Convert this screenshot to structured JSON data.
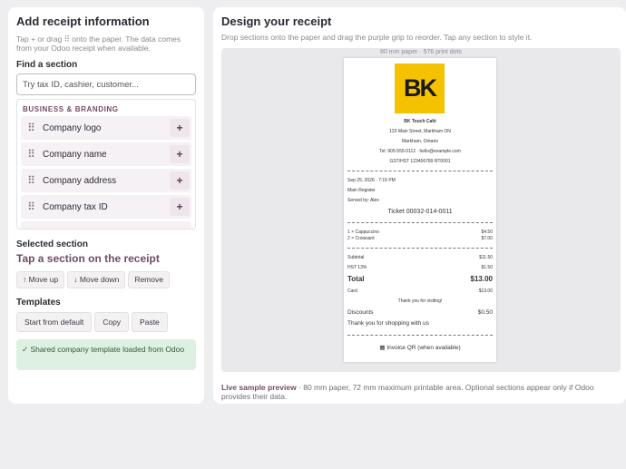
{
  "left": {
    "title": "Add receipt information",
    "hint": "Tap + or drag ⠿ onto the paper. The data comes from your Odoo receipt when available.",
    "find_label": "Find a section",
    "search_placeholder": "Try tax ID, cashier, customer...",
    "category": "BUSINESS & BRANDING",
    "items": [
      {
        "label": "Company logo",
        "add": "+"
      },
      {
        "label": "Company name",
        "add": "+"
      },
      {
        "label": "Company address",
        "add": "+"
      },
      {
        "label": "Company tax ID",
        "add": "+"
      }
    ],
    "grip": "⠿",
    "selected_label": "Selected section",
    "selected_value": "Tap a section on the receipt",
    "move_up": "↑ Move up",
    "move_down": "↓ Move down",
    "remove": "Remove",
    "templates_label": "Templates",
    "start_default": "Start from default",
    "copy": "Copy",
    "paste": "Paste",
    "template_status": "✓ Shared company template loaded from Odoo"
  },
  "right": {
    "title": "Design your receipt",
    "hint": "Drop sections onto the paper and drag the purple grip to reorder. Tap any section to style it.",
    "paper_caption": "80 mm paper · 576 print dots",
    "caption_bold": "Live sample preview",
    "caption_rest": " · 80 mm paper, 72 mm maximum printable area. Optional sections appear only if Odoo provides their data."
  },
  "receipt": {
    "logo_text": "BK",
    "company_name": "BK Touch Café",
    "address1": "123 Main Street, Markham ON",
    "address2": "Markham, Ontario",
    "contact": "Tel: 905-555-0112 · hello@example.com",
    "tax": "GST/HST 123456789 RT0001",
    "datetime": "Sep 25, 2026 · 7:15 PM",
    "register": "Main Register",
    "served_by": "Served by: Alex",
    "ticket": "Ticket 00032-014-0011",
    "lines": [
      {
        "item": "1 × Cappuccino",
        "price": "$4.50"
      },
      {
        "item": "2 × Croissant",
        "price": "$7.00"
      }
    ],
    "subtotal_label": "Subtotal",
    "subtotal": "$11.50",
    "hst_label": "HST 13%",
    "hst": "$1.50",
    "total_label": "Total",
    "total": "$13.00",
    "card_label": "Card",
    "card": "$13.00",
    "thanks": "Thank you for visiting!",
    "discounts_label": "Discounts",
    "discounts": "$0.50",
    "thanks2": "Thank you for shopping with us",
    "qr": "▦ Invoice QR (when available)"
  }
}
